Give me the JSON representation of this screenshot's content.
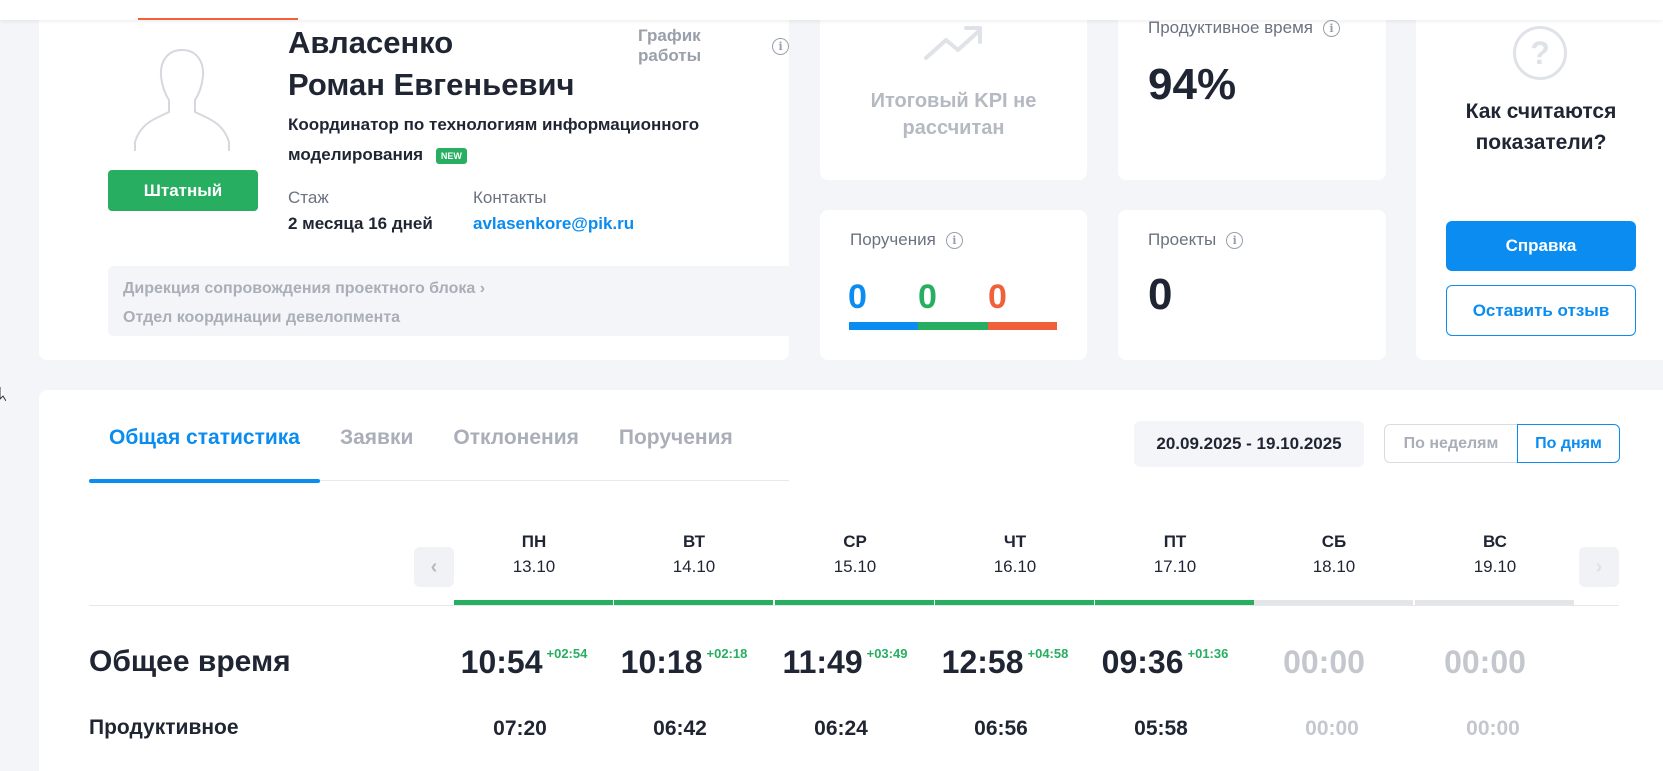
{
  "colors": {
    "accent_blue": "#0a8cf0",
    "green": "#27ae60",
    "orange": "#f0603a",
    "muted": "#c4c7cd"
  },
  "profile": {
    "last_name": "Авласенко",
    "first_name": "Роман Евгеньевич",
    "schedule_label": "График работы",
    "status": "Штатный",
    "position": "Координатор по технологиям информационного моделирования",
    "new_badge": "NEW",
    "tenure_label": "Стаж",
    "tenure_value": "2 месяца 16 дней",
    "contacts_label": "Контакты",
    "email": "avlasenkore@pik.ru",
    "department": "Дирекция сопровождения проектного блока",
    "department_chevron": "›",
    "division": "Отдел координации девелопмента"
  },
  "kpi": {
    "text_line1": "Итоговый KPI не",
    "text_line2": "рассчитан",
    "icon": "trend-up-icon"
  },
  "productive": {
    "label": "Продуктивное время",
    "value": "94%"
  },
  "help": {
    "icon_glyph": "?",
    "title_line1": "Как считаются",
    "title_line2": "показатели?",
    "primary_button": "Справка",
    "secondary_button": "Оставить отзыв"
  },
  "orders": {
    "label": "Поручения",
    "values": [
      "0",
      "0",
      "0"
    ],
    "colors": [
      "#0a8cf0",
      "#27ae60",
      "#f0603a"
    ]
  },
  "projects": {
    "label": "Проекты",
    "value": "0"
  },
  "stats": {
    "tabs": [
      "Общая статистика",
      "Заявки",
      "Отклонения",
      "Поручения"
    ],
    "date_range": "20.09.2025 - 19.10.2025",
    "view_weeks": "По неделям",
    "view_days": "По дням",
    "prev_arrow": "‹",
    "next_arrow": "›",
    "days": [
      {
        "name": "ПН",
        "date": "13.10",
        "total": "10:54",
        "delta": "+02:54",
        "productive": "07:20",
        "worked": true
      },
      {
        "name": "ВТ",
        "date": "14.10",
        "total": "10:18",
        "delta": "+02:18",
        "productive": "06:42",
        "worked": true
      },
      {
        "name": "СР",
        "date": "15.10",
        "total": "11:49",
        "delta": "+03:49",
        "productive": "06:24",
        "worked": true
      },
      {
        "name": "ЧТ",
        "date": "16.10",
        "total": "12:58",
        "delta": "+04:58",
        "productive": "06:56",
        "worked": true
      },
      {
        "name": "ПТ",
        "date": "17.10",
        "total": "09:36",
        "delta": "+01:36",
        "productive": "05:58",
        "worked": true
      },
      {
        "name": "СБ",
        "date": "18.10",
        "total": "00:00",
        "delta": "",
        "productive": "00:00",
        "worked": false
      },
      {
        "name": "ВС",
        "date": "19.10",
        "total": "00:00",
        "delta": "",
        "productive": "00:00",
        "worked": false
      }
    ],
    "row_total_label": "Общее время",
    "row_productive_label": "Продуктивное"
  }
}
